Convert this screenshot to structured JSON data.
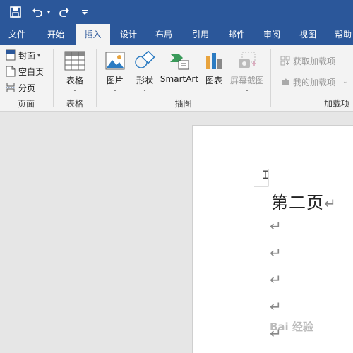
{
  "quick_access": {
    "save_icon": "save-icon",
    "undo_icon": "undo-icon",
    "redo_icon": "redo-icon",
    "customize_icon": "customize-qat-icon"
  },
  "tabs": [
    {
      "label": "文件"
    },
    {
      "label": "开始"
    },
    {
      "label": "插入",
      "active": true
    },
    {
      "label": "设计"
    },
    {
      "label": "布局"
    },
    {
      "label": "引用"
    },
    {
      "label": "邮件"
    },
    {
      "label": "审阅"
    },
    {
      "label": "视图"
    },
    {
      "label": "帮助"
    }
  ],
  "ribbon": {
    "pages_group": {
      "label": "页面",
      "cover": "封面",
      "blank_page": "空白页",
      "page_break": "分页"
    },
    "tables_group": {
      "label": "表格",
      "table": "表格"
    },
    "illustrations_group": {
      "label": "插图",
      "pictures": "图片",
      "shapes": "形状",
      "smartart": "SmartArt",
      "chart": "图表",
      "screenshot": "屏幕截图"
    },
    "addins_group": {
      "label": "加载项",
      "get_addins": "获取加载项",
      "my_addins": "我的加载项"
    }
  },
  "document": {
    "heading": "第二页",
    "paragraph_mark": "↵",
    "cursor": "I"
  },
  "colors": {
    "accent": "#2b579a",
    "ribbon_bg": "#f3f3f3",
    "canvas_bg": "#e6e6e6"
  },
  "watermark": "Bai 经验"
}
